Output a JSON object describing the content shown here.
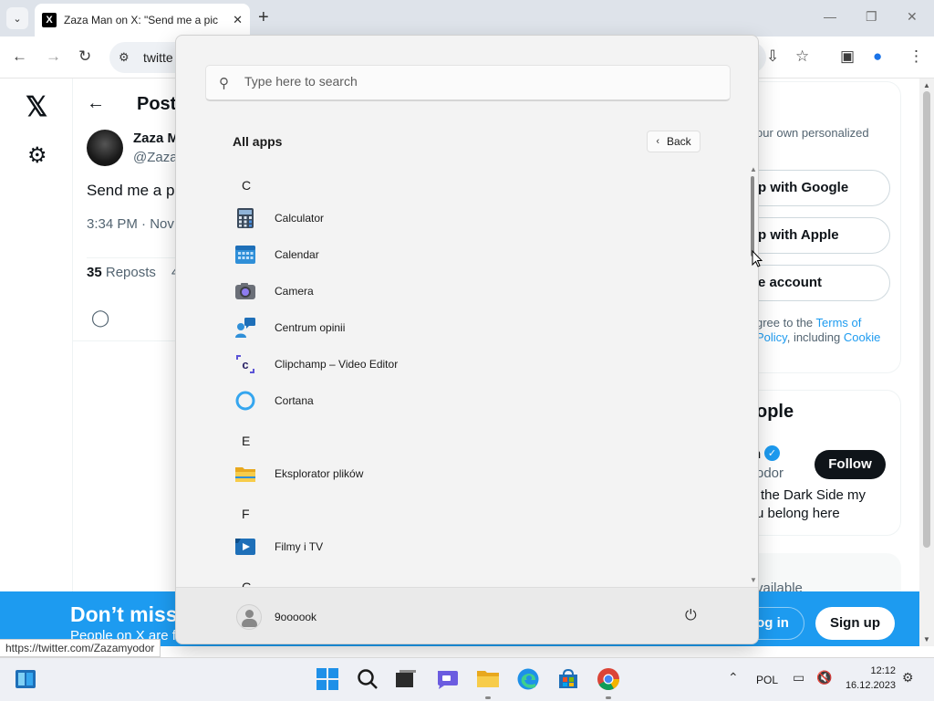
{
  "browser": {
    "tab_title": "Zaza Man on X: \"Send me a pic",
    "tab_favicon": "X",
    "address_text": "twitte",
    "status_url": "https://twitter.com/Zazamyodor"
  },
  "x_page": {
    "heading": "Post",
    "author_name": "Zaza M",
    "author_handle": "@Zaza",
    "tweet_text": "Send me a p",
    "tweet_time": "3:34 PM · Nov",
    "reposts_count": "35",
    "reposts_label": " Reposts",
    "likes_fragment": "4",
    "sidebar": {
      "signup_desc": "our own personalized",
      "google_btn": "p with Google",
      "apple_btn": "p with Apple",
      "create_btn": "e account",
      "terms_line1_pre": "gree to the ",
      "terms_line1_link": "Terms of",
      "terms_line2_link": "Policy",
      "terms_line2_mid": ", including ",
      "terms_line2_link2": "Cookie",
      "wtf_title": "ople",
      "wtf_name": "n",
      "wtf_handle": "odor",
      "follow_label": "Follow",
      "wtf_bio1": "the Dark Side my",
      "wtf_bio2": "u belong here",
      "trend_text": "vailable"
    },
    "banner": {
      "title": "Don’t miss",
      "subtitle": "People on X are f",
      "login_label": "og in",
      "signup_label": "Sign up"
    }
  },
  "start_menu": {
    "search_placeholder": "Type here to search",
    "all_apps_label": "All apps",
    "back_label": "Back",
    "sections": [
      {
        "letter": "C"
      },
      {
        "letter": "E"
      },
      {
        "letter": "F"
      },
      {
        "letter": "G"
      }
    ],
    "apps": [
      {
        "name": "Calculator",
        "icon": "calculator-icon"
      },
      {
        "name": "Calendar",
        "icon": "calendar-icon"
      },
      {
        "name": "Camera",
        "icon": "camera-icon"
      },
      {
        "name": "Centrum opinii",
        "icon": "feedback-hub-icon"
      },
      {
        "name": "Clipchamp – Video Editor",
        "icon": "clipchamp-icon"
      },
      {
        "name": "Cortana",
        "icon": "cortana-icon"
      },
      {
        "name": "Eksplorator plików",
        "icon": "file-explorer-icon"
      },
      {
        "name": "Filmy i TV",
        "icon": "movies-tv-icon"
      }
    ],
    "user_name": "9oooook"
  },
  "taskbar": {
    "language": "POL",
    "time": "12:12",
    "date": "16.12.2023"
  }
}
